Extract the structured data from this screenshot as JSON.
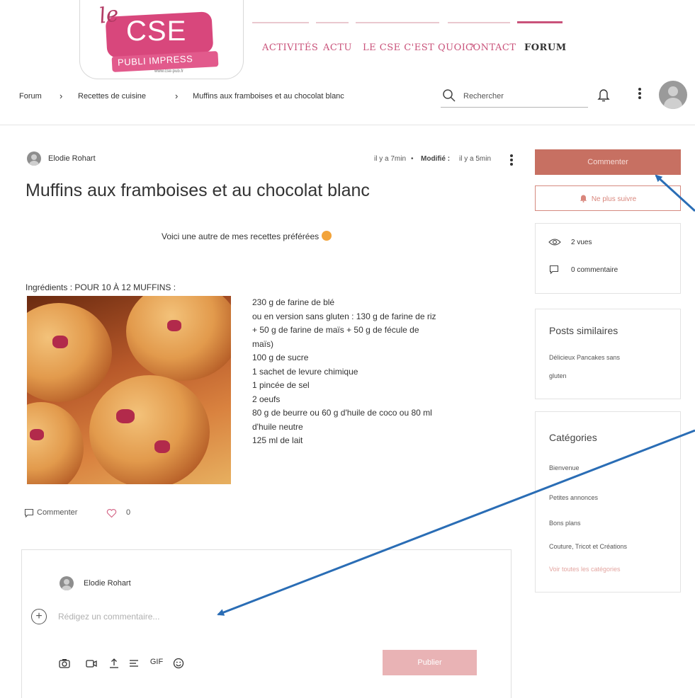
{
  "logo": {
    "le": "le",
    "cse": "CSE",
    "band": "PUBLI IMPRESS",
    "url": "www.cse-pub.fr"
  },
  "nav": [
    {
      "label": "ACTIVITÉS"
    },
    {
      "label": "ACTU"
    },
    {
      "label": "LE CSE C'EST QUOI ?"
    },
    {
      "label": "CONTACT"
    },
    {
      "label": "FORUM",
      "active": true
    }
  ],
  "breadcrumb": [
    "Forum",
    "Recettes de cuisine",
    "Muffins aux framboises et au chocolat blanc"
  ],
  "search": {
    "placeholder": "Rechercher"
  },
  "post": {
    "author": "Elodie Rohart",
    "time": "il y a 7min",
    "modified_label": "Modifié :",
    "modified_time": "il y a 5min",
    "title": "Muffins aux framboises et au chocolat blanc",
    "intro": "Voici une autre de mes recettes préférées",
    "ingredients_heading": "Ingrédients : POUR 10 À 12 MUFFINS :",
    "ingredients": [
      "230 g de farine de blé",
      "ou en version sans gluten : 130 g de farine de riz",
      "+ 50 g de farine de maïs + 50 g de fécule de",
      "maïs)",
      "100 g de sucre",
      "1 sachet de levure chimique",
      "1 pincée de sel",
      "2 oeufs",
      "80 g de beurre ou 60 g d'huile de coco ou 80 ml",
      "d'huile neutre",
      "125 ml de lait"
    ],
    "comment_action": "Commenter",
    "likes": "0"
  },
  "composer": {
    "author": "Elodie Rohart",
    "placeholder": "Rédigez un commentaire...",
    "gif_label": "GIF",
    "publish_label": "Publier"
  },
  "sidebar": {
    "comment_button": "Commenter",
    "unfollow_button": "Ne plus suivre",
    "views": "2 vues",
    "comments": "0 commentaire",
    "similar_heading": "Posts similaires",
    "similar_posts": [
      "Délicieux Pancakes sans",
      "gluten"
    ],
    "categories_heading": "Catégories",
    "categories": [
      "Bienvenue",
      "Petites annonces",
      "Bons plans",
      "Couture, Tricot et Créations"
    ],
    "all_categories_link": "Voir toutes les catégories"
  },
  "colors": {
    "accent": "#c9527a",
    "comment_button": "#c77062",
    "publish_button": "#e9b3b5",
    "annotation_arrow": "#2a6db5"
  }
}
